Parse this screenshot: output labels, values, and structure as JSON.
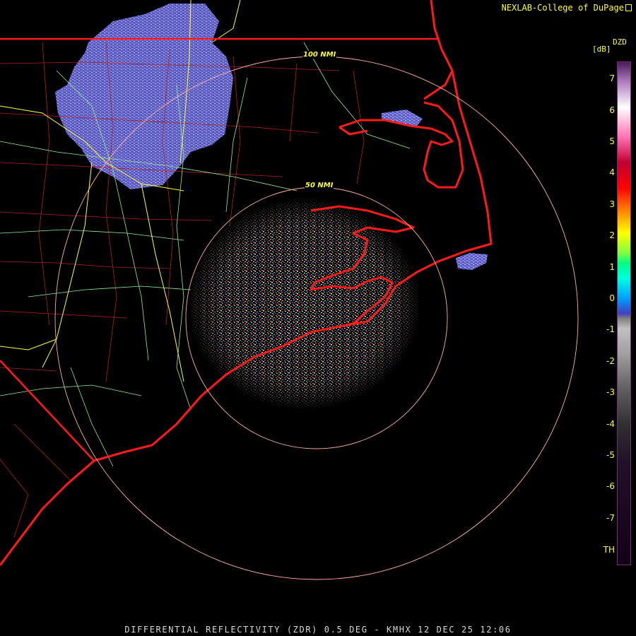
{
  "header": {
    "brand": "NEXLAB-College of DuPage",
    "product_code": "DZD",
    "units": "[dB]"
  },
  "rings": [
    {
      "label": "100 NMI"
    },
    {
      "label": "50 NMI"
    }
  ],
  "color_scale": {
    "ticks": [
      "7",
      "6",
      "5",
      "4",
      "3",
      "2",
      "1",
      "0",
      "-1",
      "-2",
      "-3",
      "-4",
      "-5",
      "-6",
      "-7",
      "TH"
    ]
  },
  "footer": {
    "caption": "DIFFERENTIAL REFLECTIVITY (ZDR) 0.5 DEG - KMHX 12 DEC 25 12:06"
  },
  "colors": {
    "background": "#000000",
    "text": "#ffff33",
    "coastline": "#ff1a1a",
    "county_lines": "#b02020",
    "highways": "#ffff33",
    "roads": "#90ee90",
    "range_rings": "#ffb0a0",
    "precip": "#6a6ad8"
  }
}
